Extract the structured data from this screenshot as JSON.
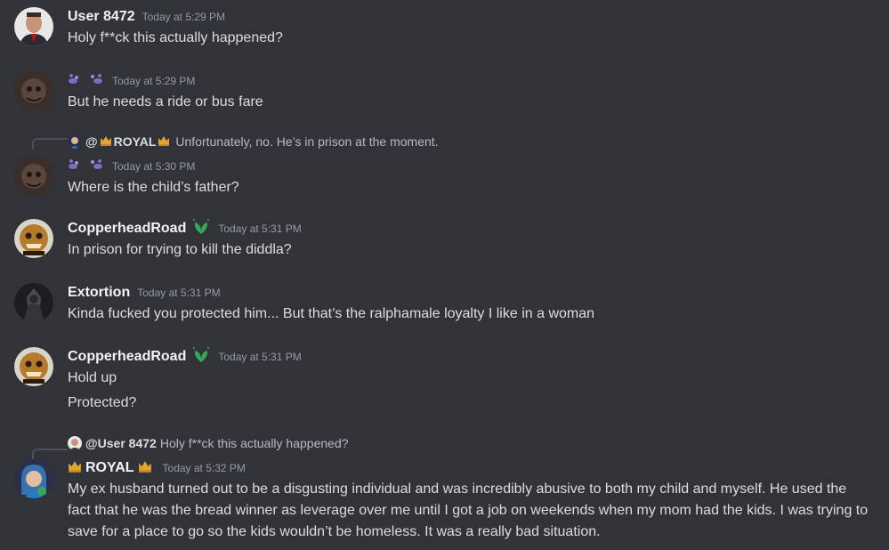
{
  "messages": [
    {
      "author": "User 8472",
      "time": "Today at 5:29 PM",
      "lines": [
        "Holy f**ck this actually happened?"
      ]
    },
    {
      "author": "",
      "time": "Today at 5:29 PM",
      "lines": [
        "But he needs a ride or bus fare"
      ]
    },
    {
      "reply": {
        "prefix": "@",
        "author": "ROYAL",
        "text": "Unfortunately, no. He’s in prison at the moment."
      },
      "author": "",
      "time": "Today at 5:30 PM",
      "lines": [
        "Where is the child’s father?"
      ]
    },
    {
      "author": "CopperheadRoad",
      "time": "Today at 5:31 PM",
      "lines": [
        "In prison for trying to kill the diddla?"
      ]
    },
    {
      "author": "Extortion",
      "time": "Today at 5:31 PM",
      "lines": [
        "Kinda fucked you protected him... But that’s the ralphamale loyalty I like in a woman"
      ]
    },
    {
      "author": "CopperheadRoad",
      "time": "Today at 5:31 PM",
      "lines": [
        "Hold up",
        "Protected?"
      ]
    },
    {
      "reply": {
        "author": "@User 8472",
        "text": "Holy f**ck this actually happened?"
      },
      "author": "ROYAL",
      "time": "Today at 5:32 PM",
      "lines": [
        "My ex husband turned out to be a disgusting individual and was incredibly abusive to both my child and myself. He used the fact that he was the bread winner as leverage over me until I got a job on weekends when my mom had the kids. I was trying to save for a place to go so the kids wouldn’t be homeless. It was a really bad situation."
      ]
    }
  ],
  "icons": {
    "crown": "crown-icon",
    "paw_prints": "paw-print-icon",
    "leaf_badge": "leaf-badge-icon"
  },
  "colors": {
    "background": "#323339",
    "username": "#f2f3f5",
    "timestamp": "#949ba4",
    "text": "#dbdee1",
    "paw": "#7b6fc4",
    "crown": "#e0a534",
    "leaf": "#3ba55d"
  }
}
